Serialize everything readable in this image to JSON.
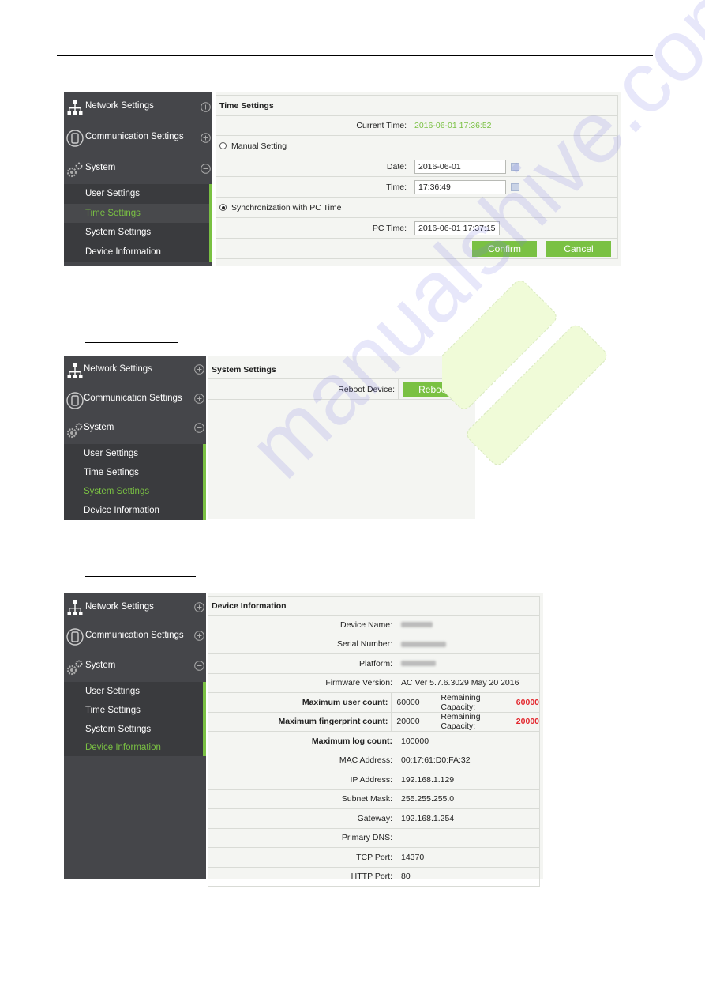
{
  "watermark": {
    "text": "manualshive.com"
  },
  "nav": {
    "network": "Network Settings",
    "communication": "Communication Settings",
    "system": "System",
    "sub": [
      "User Settings",
      "Time Settings",
      "System Settings",
      "Device Information"
    ]
  },
  "icons": {
    "network": "network-tree-icon",
    "communication": "device-icon",
    "system": "gears-icon",
    "expand": "plus-circle-icon",
    "collapse": "minus-circle-icon",
    "calendar": "calendar-icon"
  },
  "colors": {
    "accent": "#7ac143",
    "sidebar": "#45464a",
    "highlight": "#e3262d"
  },
  "time_settings": {
    "title": "Time Settings",
    "current_time_label": "Current Time:",
    "current_time_value": "2016-06-01 17:36:52",
    "manual_label": "Manual Setting",
    "manual_selected": false,
    "date_label": "Date:",
    "date_value": "2016-06-01",
    "time_label": "Time:",
    "time_value": "17:36:49",
    "sync_label": "Synchronization with PC Time",
    "sync_selected": true,
    "pc_time_label": "PC Time:",
    "pc_time_value": "2016-06-01 17:37:15",
    "confirm": "Confirm",
    "cancel": "Cancel",
    "active_sub": "Time Settings"
  },
  "system_settings": {
    "title": "System Settings",
    "reboot_label": "Reboot Device:",
    "reboot_button": "Reboot",
    "active_sub": "System Settings"
  },
  "device_info": {
    "title": "Device Information",
    "active_sub": "Device Information",
    "rows": [
      {
        "label": "Device Name:",
        "value": "",
        "blurred": true
      },
      {
        "label": "Serial Number:",
        "value": "",
        "blurred": true
      },
      {
        "label": "Platform:",
        "value": "",
        "blurred": true
      },
      {
        "label": "Firmware Version:",
        "value": "AC Ver 5.7.6.3029 May 20 2016"
      },
      {
        "label": "Maximum user count:",
        "value": "60000",
        "bold_label": true,
        "remaining_label": "Remaining Capacity:",
        "remaining_value": "60000"
      },
      {
        "label": "Maximum fingerprint count:",
        "value": "20000",
        "bold_label": true,
        "remaining_label": "Remaining Capacity:",
        "remaining_value": "20000"
      },
      {
        "label": "Maximum log count:",
        "value": "100000",
        "bold_label": true
      },
      {
        "label": "MAC Address:",
        "value": "00:17:61:D0:FA:32"
      },
      {
        "label": "IP Address:",
        "value": "192.168.1.129"
      },
      {
        "label": "Subnet Mask:",
        "value": "255.255.255.0"
      },
      {
        "label": "Gateway:",
        "value": "192.168.1.254"
      },
      {
        "label": "Primary DNS:",
        "value": ""
      },
      {
        "label": "TCP Port:",
        "value": "14370"
      },
      {
        "label": "HTTP Port:",
        "value": "80"
      }
    ]
  }
}
